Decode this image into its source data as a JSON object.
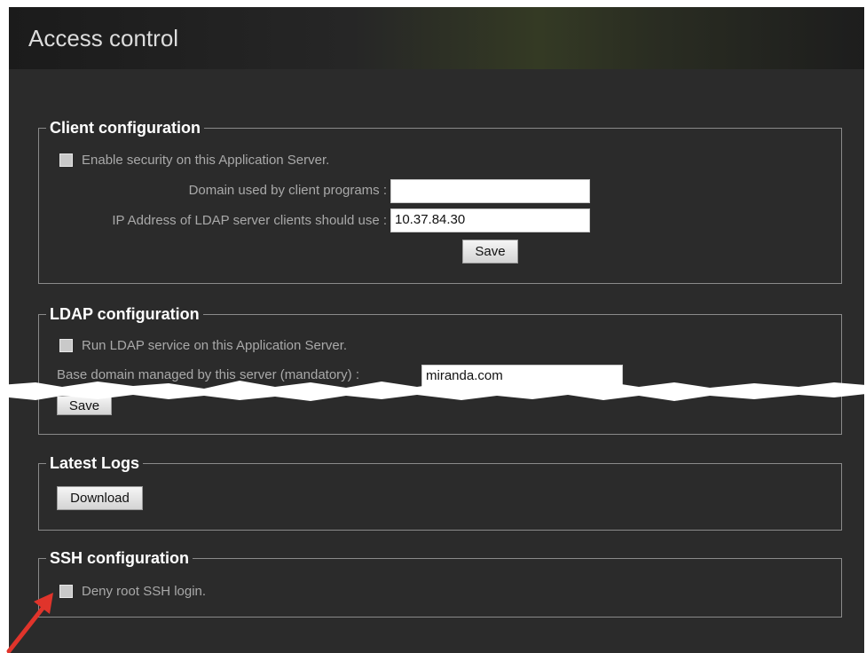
{
  "header": {
    "title": "Access control"
  },
  "client_config": {
    "legend": "Client configuration",
    "enable_security_label": "Enable security on this Application Server.",
    "domain_label": "Domain used by client programs :",
    "domain_value": "",
    "ip_label": "IP Address of LDAP server clients should use :",
    "ip_value": "10.37.84.30",
    "save_label": "Save"
  },
  "ldap_config": {
    "legend": "LDAP configuration",
    "run_ldap_label": "Run LDAP service on this Application Server.",
    "base_domain_label": "Base domain managed by this server (mandatory) :",
    "base_domain_value": "miranda.com",
    "save_label": "Save"
  },
  "latest_logs": {
    "legend": "Latest Logs",
    "download_label": "Download"
  },
  "ssh_config": {
    "legend": "SSH configuration",
    "deny_root_label": "Deny root SSH login."
  },
  "colors": {
    "panel_bg": "#2b2b2b",
    "annotation_arrow": "#e0342b"
  }
}
